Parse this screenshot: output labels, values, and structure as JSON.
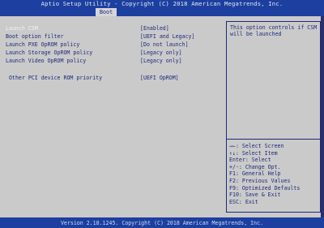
{
  "header": {
    "title": "Aptio Setup Utility - Copyright (C) 2018 American Megatrends, Inc.",
    "tab": "Boot"
  },
  "settings": [
    {
      "label": "Launch CSM",
      "value": "[Enabled]",
      "selected": true
    },
    {
      "label": "Boot option filter",
      "value": "[UEFI and Legacy]"
    },
    {
      "label": "Launch PXE OpROM policy",
      "value": "[Do not launch]"
    },
    {
      "label": "Launch Storage OpROM policy",
      "value": "[Legacy only]"
    },
    {
      "label": "Launch Video OpROM policy",
      "value": "[Legacy only]"
    },
    {
      "label": "Other PCI device ROM priority",
      "value": "[UEFI OpROM]"
    }
  ],
  "help": {
    "text": "This option controls if CSM will be launched"
  },
  "keys": [
    "→←: Select Screen",
    "↑↓: Select Item",
    "Enter: Select",
    "+/-: Change Opt.",
    "F1: General Help",
    "F2: Previous Values",
    "F9: Optimized Defaults",
    "F10: Save & Exit",
    "ESC: Exit"
  ],
  "footer": "Version 2.18.1245. Copyright (C) 2018 American Megatrends, Inc.",
  "colors": {
    "bar": "#1c3fa0",
    "panel": "#cacaca",
    "text": "#1c2b78",
    "selected": "#f2f2f2"
  }
}
